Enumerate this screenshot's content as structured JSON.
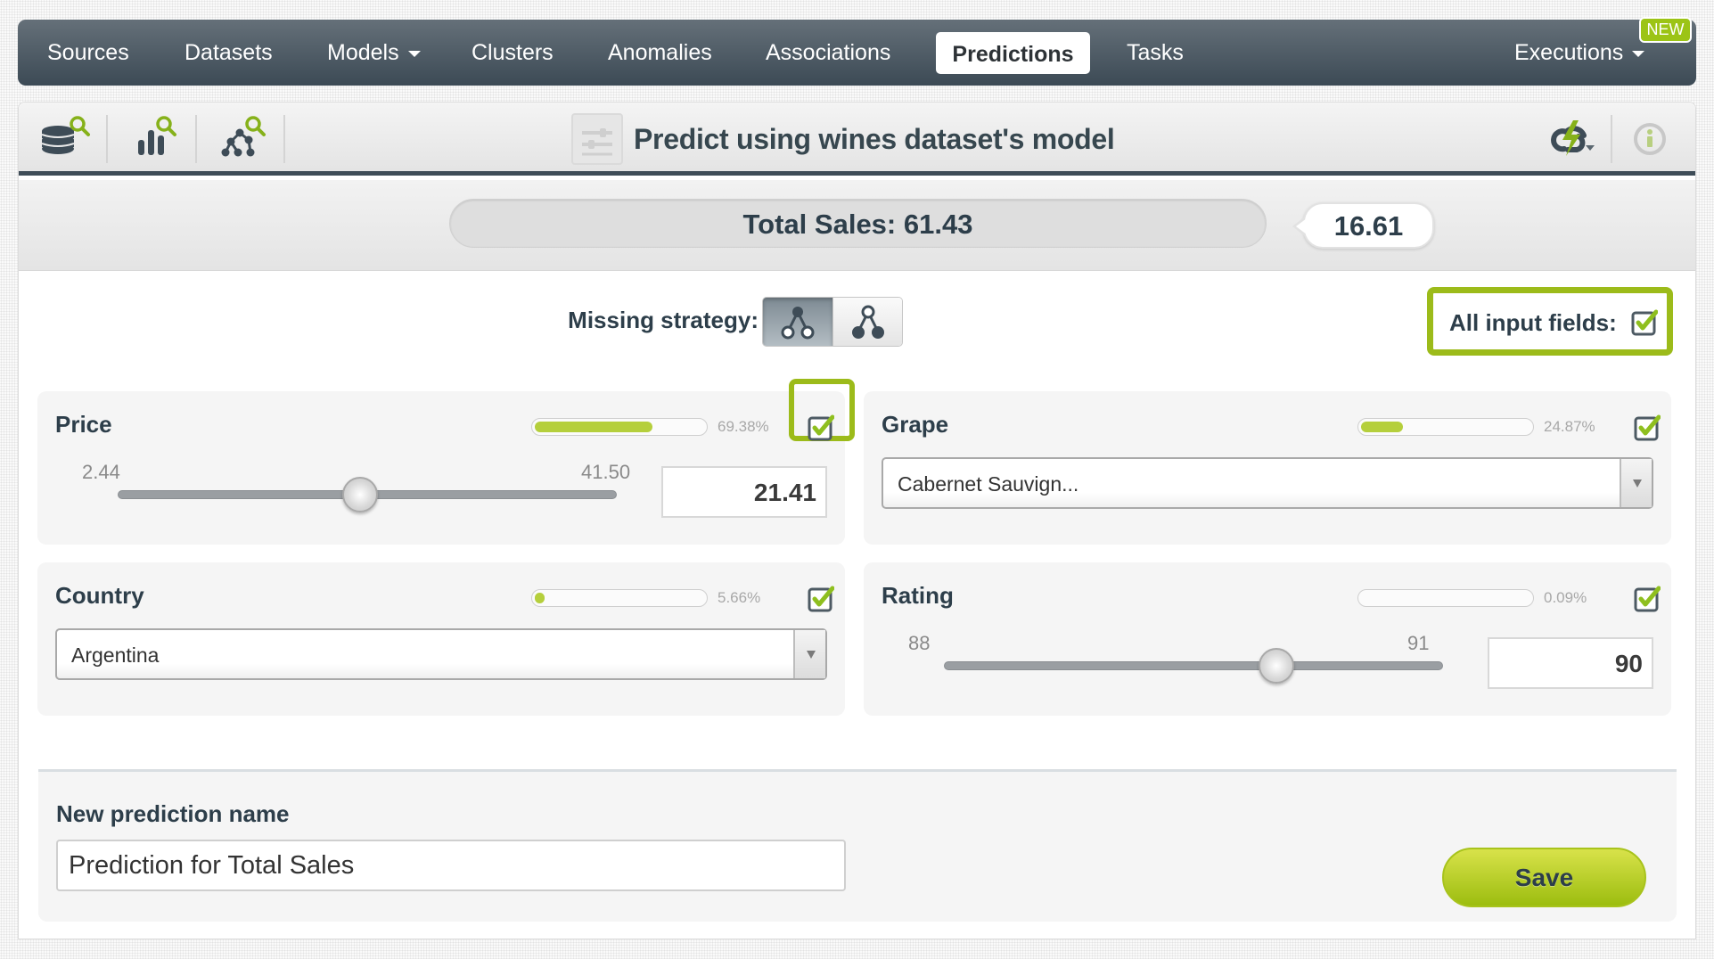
{
  "nav": {
    "items": [
      {
        "label": "Sources"
      },
      {
        "label": "Datasets"
      },
      {
        "label": "Models",
        "has_dropdown": true
      },
      {
        "label": "Clusters"
      },
      {
        "label": "Anomalies"
      },
      {
        "label": "Associations"
      },
      {
        "label": "Predictions",
        "active": true
      },
      {
        "label": "Tasks"
      },
      {
        "label": "Executions",
        "has_dropdown": true,
        "badge": "NEW"
      }
    ]
  },
  "toolbar": {
    "icons": [
      "dataset-search-icon",
      "model-search-icon",
      "ensemble-search-icon"
    ],
    "title": "Predict using wines dataset's model",
    "right_icons": [
      "batch-prediction-lightning-icon",
      "info-icon"
    ]
  },
  "prediction": {
    "label": "Total Sales: 61.43",
    "objective_name": "Total Sales",
    "value": "61.43",
    "confidence": "16.61"
  },
  "missing_strategy": {
    "label": "Missing strategy:",
    "options": [
      "last-prediction",
      "proportional"
    ],
    "selected": "last-prediction"
  },
  "all_input_fields": {
    "label": "All input fields:",
    "checked": true
  },
  "fields": [
    {
      "name": "Price",
      "importance_pct": 69.38,
      "importance_label": "69.38%",
      "type": "numeric",
      "min": "2.44",
      "max": "41.50",
      "value": "21.41",
      "checked": true,
      "highlighted": true
    },
    {
      "name": "Grape",
      "importance_pct": 24.87,
      "importance_label": "24.87%",
      "type": "categorical",
      "value": "Cabernet Sauvign...",
      "checked": true
    },
    {
      "name": "Country",
      "importance_pct": 5.66,
      "importance_label": "5.66%",
      "type": "categorical",
      "value": "Argentina",
      "checked": true
    },
    {
      "name": "Rating",
      "importance_pct": 0.09,
      "importance_label": "0.09%",
      "type": "numeric",
      "min": "88",
      "max": "91",
      "value": "90",
      "checked": true
    }
  ],
  "new_prediction": {
    "label": "New prediction name",
    "value": "Prediction for Total Sales",
    "save_label": "Save"
  },
  "colors": {
    "accent_green": "#9cbb1a",
    "nav_dark": "#3c4a55",
    "text_dark": "#2d3e4a",
    "importance_fill": "#b5cf3c"
  }
}
